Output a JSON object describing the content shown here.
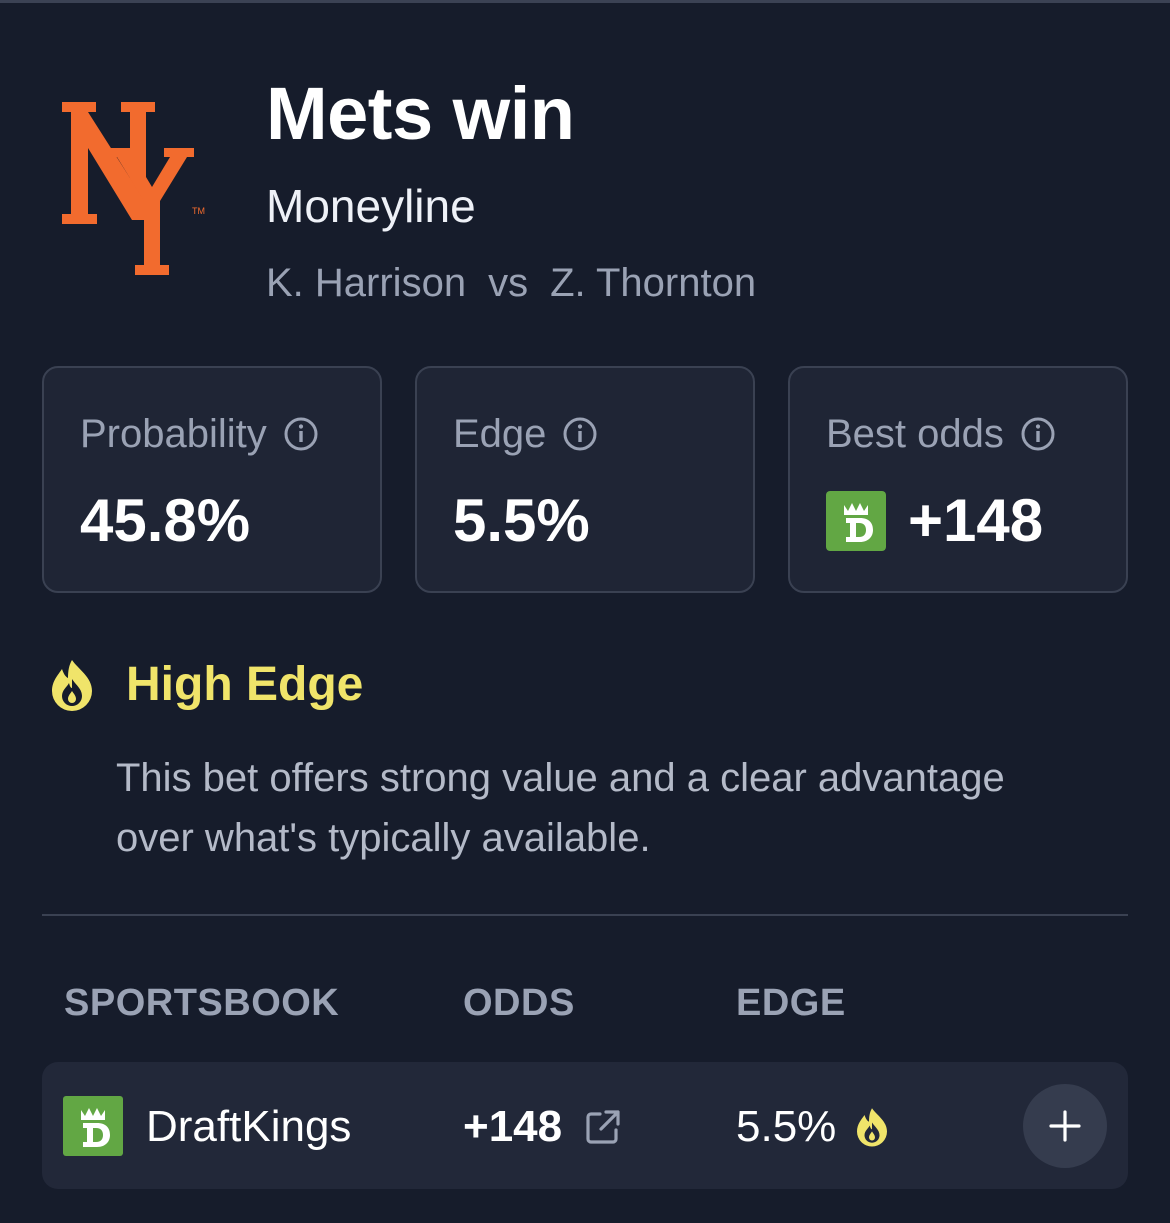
{
  "header": {
    "title": "Mets win",
    "subtitle": "Moneyline",
    "matchup": {
      "team_a": "K. Harrison",
      "vs": "vs",
      "team_b": "Z. Thornton"
    },
    "logo": {
      "name": "mets-logo-icon",
      "text": "NY",
      "trademark": "TM",
      "color": "#f26b2e"
    }
  },
  "stats": [
    {
      "label": "Probability",
      "value": "45.8%",
      "icon": "info-icon"
    },
    {
      "label": "Edge",
      "value": "5.5%",
      "icon": "info-icon"
    },
    {
      "label": "Best odds",
      "value": "+148",
      "icon": "info-icon",
      "book_icon": "draftkings-logo-icon"
    }
  ],
  "edge_badge": {
    "icon": "flame-icon",
    "title": "High Edge",
    "description": "This bet offers strong value and a clear advantage over what's typically available.",
    "color": "#f0e46a"
  },
  "table": {
    "headers": {
      "sportsbook": "SPORTSBOOK",
      "odds": "ODDS",
      "edge": "EDGE"
    },
    "rows": [
      {
        "book": "DraftKings",
        "book_icon": "draftkings-logo-icon",
        "odds": "+148",
        "edge": "5.5%",
        "action": "+"
      }
    ]
  },
  "colors": {
    "background": "#161c2b",
    "card": "#1f2535",
    "accent": "#f0e46a",
    "draftkings": "#62a744"
  }
}
